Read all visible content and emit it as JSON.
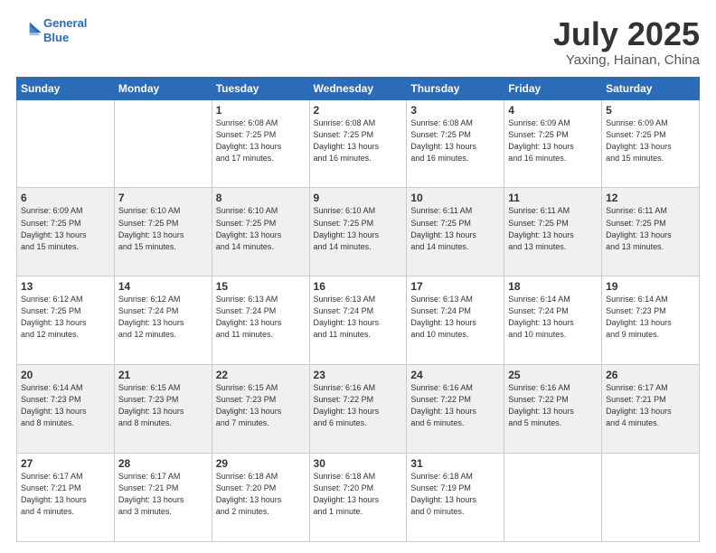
{
  "header": {
    "logo_line1": "General",
    "logo_line2": "Blue",
    "title": "July 2025",
    "subtitle": "Yaxing, Hainan, China"
  },
  "weekdays": [
    "Sunday",
    "Monday",
    "Tuesday",
    "Wednesday",
    "Thursday",
    "Friday",
    "Saturday"
  ],
  "weeks": [
    [
      {
        "day": "",
        "info": ""
      },
      {
        "day": "",
        "info": ""
      },
      {
        "day": "1",
        "info": "Sunrise: 6:08 AM\nSunset: 7:25 PM\nDaylight: 13 hours\nand 17 minutes."
      },
      {
        "day": "2",
        "info": "Sunrise: 6:08 AM\nSunset: 7:25 PM\nDaylight: 13 hours\nand 16 minutes."
      },
      {
        "day": "3",
        "info": "Sunrise: 6:08 AM\nSunset: 7:25 PM\nDaylight: 13 hours\nand 16 minutes."
      },
      {
        "day": "4",
        "info": "Sunrise: 6:09 AM\nSunset: 7:25 PM\nDaylight: 13 hours\nand 16 minutes."
      },
      {
        "day": "5",
        "info": "Sunrise: 6:09 AM\nSunset: 7:25 PM\nDaylight: 13 hours\nand 15 minutes."
      }
    ],
    [
      {
        "day": "6",
        "info": "Sunrise: 6:09 AM\nSunset: 7:25 PM\nDaylight: 13 hours\nand 15 minutes."
      },
      {
        "day": "7",
        "info": "Sunrise: 6:10 AM\nSunset: 7:25 PM\nDaylight: 13 hours\nand 15 minutes."
      },
      {
        "day": "8",
        "info": "Sunrise: 6:10 AM\nSunset: 7:25 PM\nDaylight: 13 hours\nand 14 minutes."
      },
      {
        "day": "9",
        "info": "Sunrise: 6:10 AM\nSunset: 7:25 PM\nDaylight: 13 hours\nand 14 minutes."
      },
      {
        "day": "10",
        "info": "Sunrise: 6:11 AM\nSunset: 7:25 PM\nDaylight: 13 hours\nand 14 minutes."
      },
      {
        "day": "11",
        "info": "Sunrise: 6:11 AM\nSunset: 7:25 PM\nDaylight: 13 hours\nand 13 minutes."
      },
      {
        "day": "12",
        "info": "Sunrise: 6:11 AM\nSunset: 7:25 PM\nDaylight: 13 hours\nand 13 minutes."
      }
    ],
    [
      {
        "day": "13",
        "info": "Sunrise: 6:12 AM\nSunset: 7:25 PM\nDaylight: 13 hours\nand 12 minutes."
      },
      {
        "day": "14",
        "info": "Sunrise: 6:12 AM\nSunset: 7:24 PM\nDaylight: 13 hours\nand 12 minutes."
      },
      {
        "day": "15",
        "info": "Sunrise: 6:13 AM\nSunset: 7:24 PM\nDaylight: 13 hours\nand 11 minutes."
      },
      {
        "day": "16",
        "info": "Sunrise: 6:13 AM\nSunset: 7:24 PM\nDaylight: 13 hours\nand 11 minutes."
      },
      {
        "day": "17",
        "info": "Sunrise: 6:13 AM\nSunset: 7:24 PM\nDaylight: 13 hours\nand 10 minutes."
      },
      {
        "day": "18",
        "info": "Sunrise: 6:14 AM\nSunset: 7:24 PM\nDaylight: 13 hours\nand 10 minutes."
      },
      {
        "day": "19",
        "info": "Sunrise: 6:14 AM\nSunset: 7:23 PM\nDaylight: 13 hours\nand 9 minutes."
      }
    ],
    [
      {
        "day": "20",
        "info": "Sunrise: 6:14 AM\nSunset: 7:23 PM\nDaylight: 13 hours\nand 8 minutes."
      },
      {
        "day": "21",
        "info": "Sunrise: 6:15 AM\nSunset: 7:23 PM\nDaylight: 13 hours\nand 8 minutes."
      },
      {
        "day": "22",
        "info": "Sunrise: 6:15 AM\nSunset: 7:23 PM\nDaylight: 13 hours\nand 7 minutes."
      },
      {
        "day": "23",
        "info": "Sunrise: 6:16 AM\nSunset: 7:22 PM\nDaylight: 13 hours\nand 6 minutes."
      },
      {
        "day": "24",
        "info": "Sunrise: 6:16 AM\nSunset: 7:22 PM\nDaylight: 13 hours\nand 6 minutes."
      },
      {
        "day": "25",
        "info": "Sunrise: 6:16 AM\nSunset: 7:22 PM\nDaylight: 13 hours\nand 5 minutes."
      },
      {
        "day": "26",
        "info": "Sunrise: 6:17 AM\nSunset: 7:21 PM\nDaylight: 13 hours\nand 4 minutes."
      }
    ],
    [
      {
        "day": "27",
        "info": "Sunrise: 6:17 AM\nSunset: 7:21 PM\nDaylight: 13 hours\nand 4 minutes."
      },
      {
        "day": "28",
        "info": "Sunrise: 6:17 AM\nSunset: 7:21 PM\nDaylight: 13 hours\nand 3 minutes."
      },
      {
        "day": "29",
        "info": "Sunrise: 6:18 AM\nSunset: 7:20 PM\nDaylight: 13 hours\nand 2 minutes."
      },
      {
        "day": "30",
        "info": "Sunrise: 6:18 AM\nSunset: 7:20 PM\nDaylight: 13 hours\nand 1 minute."
      },
      {
        "day": "31",
        "info": "Sunrise: 6:18 AM\nSunset: 7:19 PM\nDaylight: 13 hours\nand 0 minutes."
      },
      {
        "day": "",
        "info": ""
      },
      {
        "day": "",
        "info": ""
      }
    ]
  ]
}
